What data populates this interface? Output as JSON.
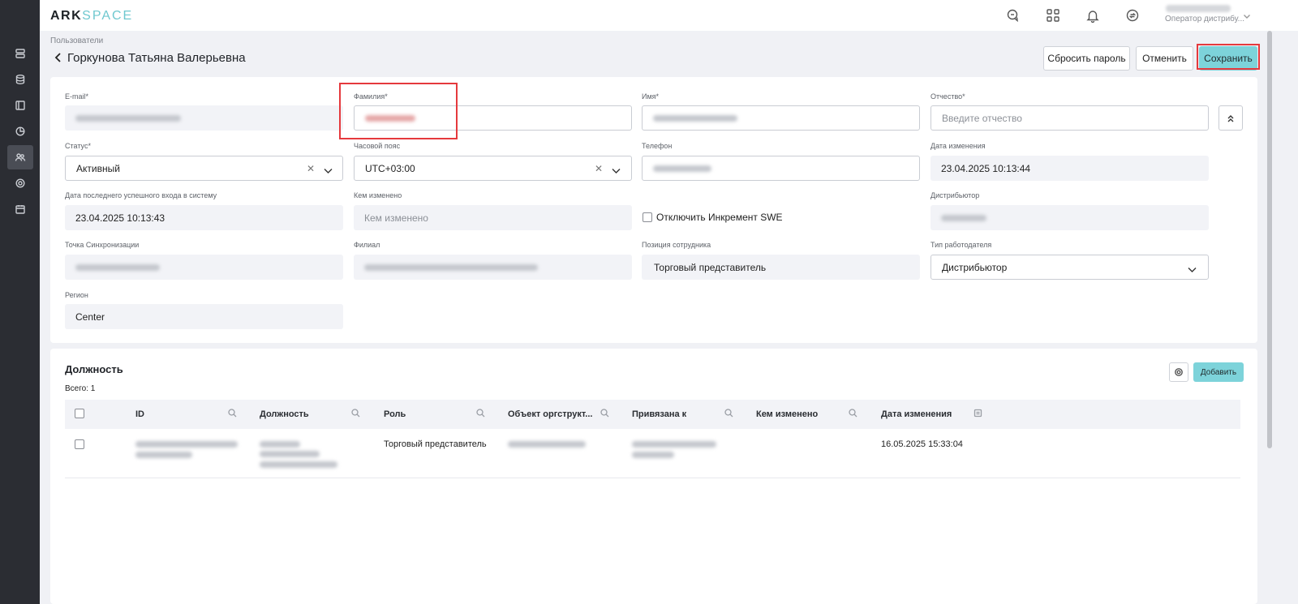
{
  "app": {
    "logo_primary": "ARK",
    "logo_secondary": "SPACE",
    "user_name": "Фамилия Имя",
    "user_role": "Оператор дистрибу..."
  },
  "sidebar": {
    "items": [
      {
        "icon": "server-icon",
        "active": false
      },
      {
        "icon": "database-icon",
        "active": false
      },
      {
        "icon": "layout-icon",
        "active": false
      },
      {
        "icon": "pie-chart-icon",
        "active": false
      },
      {
        "icon": "users-icon",
        "active": true
      },
      {
        "icon": "settings-icon",
        "active": false
      },
      {
        "icon": "calendar-icon",
        "active": false
      }
    ]
  },
  "topbar_icons": [
    "chat-icon",
    "apps-grid-icon",
    "bell-icon",
    "sync-icon"
  ],
  "breadcrumb": "Пользователи",
  "title": "Горкунова Татьяна Валерьевна",
  "buttons": {
    "reset_password": "Сбросить пароль",
    "cancel": "Отменить",
    "save": "Сохранить"
  },
  "form": {
    "email": {
      "label": "E-mail*",
      "value": "скрыто"
    },
    "last_name": {
      "label": "Фамилия*",
      "value": "скрыто"
    },
    "first_name": {
      "label": "Имя*",
      "value": "скрыто"
    },
    "patronymic": {
      "label": "Отчество*",
      "placeholder": "Введите отчество"
    },
    "status": {
      "label": "Статус*",
      "value": "Активный"
    },
    "timezone": {
      "label": "Часовой пояс",
      "value": "UTC+03:00"
    },
    "phone": {
      "label": "Телефон",
      "value": "скрыто"
    },
    "modified_date": {
      "label": "Дата изменения",
      "value": "23.04.2025 10:13:44"
    },
    "last_login": {
      "label": "Дата последнего успешного входа в систему",
      "value": "23.04.2025 10:13:43"
    },
    "modified_by": {
      "label": "Кем изменено",
      "placeholder": "Кем изменено"
    },
    "disable_swe": {
      "label": "Отключить Инкремент SWE",
      "checked": false
    },
    "distributor": {
      "label": "Дистрибьютор",
      "value": "скрыто"
    },
    "sync_point": {
      "label": "Точка Синхронизации",
      "value": "скрыто"
    },
    "branch": {
      "label": "Филиал",
      "value": "скрыто"
    },
    "employee_position": {
      "label": "Позиция сотрудника",
      "value": "Торговый представитель"
    },
    "employer_type": {
      "label": "Тип работодателя",
      "value": "Дистрибьютор"
    },
    "region": {
      "label": "Регион",
      "value": "Center"
    }
  },
  "positions": {
    "title": "Должность",
    "total": "Всего: 1",
    "add_label": "Добавить",
    "columns": [
      "ID",
      "Должность",
      "Роль",
      "Объект оргструкт...",
      "Привязана к",
      "Кем изменено",
      "Дата изменения"
    ],
    "rows": [
      {
        "role": "Торговый представитель",
        "modified_date": "16.05.2025 15:33:04"
      }
    ]
  }
}
